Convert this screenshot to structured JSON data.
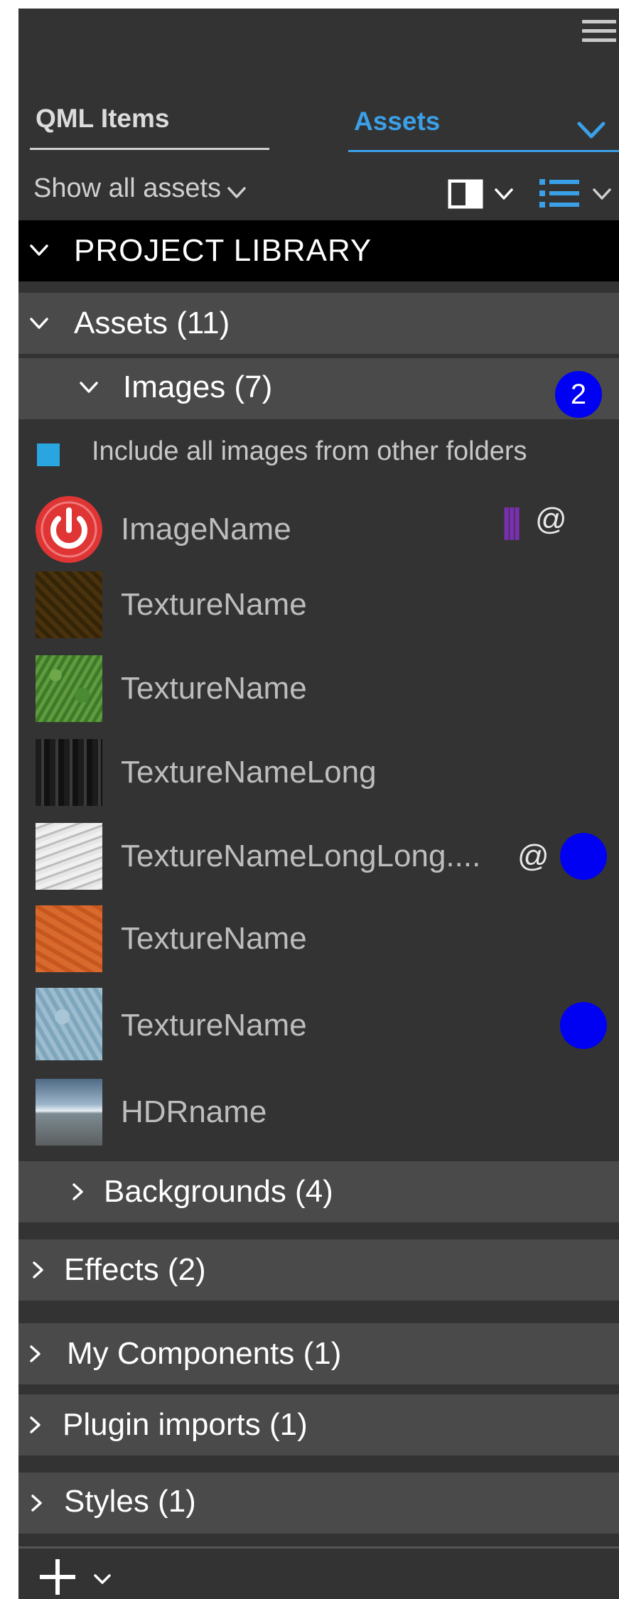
{
  "tabs": {
    "qml_items": "QML Items",
    "assets": "Assets"
  },
  "filter": {
    "show_all": "Show all assets"
  },
  "library": {
    "title": "PROJECT  LIBRARY"
  },
  "assets_section": {
    "title": "Assets (11)"
  },
  "images_section": {
    "title": "Images (7)",
    "badge": "2",
    "include_label": "Include all images  from other folders",
    "items": [
      {
        "name": "ImageName",
        "at": "@",
        "pipes": "|||"
      },
      {
        "name": "TextureName"
      },
      {
        "name": "TextureName"
      },
      {
        "name": "TextureNameLong"
      },
      {
        "name": "TextureNameLongLong....",
        "at": "@"
      },
      {
        "name": "TextureName"
      },
      {
        "name": "TextureName"
      },
      {
        "name": "HDRname"
      }
    ]
  },
  "groups": {
    "backgrounds": "Backgrounds (4)",
    "effects": "Effects (2)",
    "my_components": "My Components (1)",
    "plugin_imports": "Plugin imports (1)",
    "styles": "Styles (1)"
  },
  "colors": {
    "accent": "#3aa0e8",
    "badge": "#0000f2",
    "marker": "#7a2fb0",
    "check": "#29a6e0"
  },
  "icons": [
    "hamburger-menu-icon",
    "chevron-down-icon",
    "panel-toggle-icon",
    "list-view-icon",
    "chevron-right-icon",
    "power-icon",
    "plus-icon"
  ]
}
